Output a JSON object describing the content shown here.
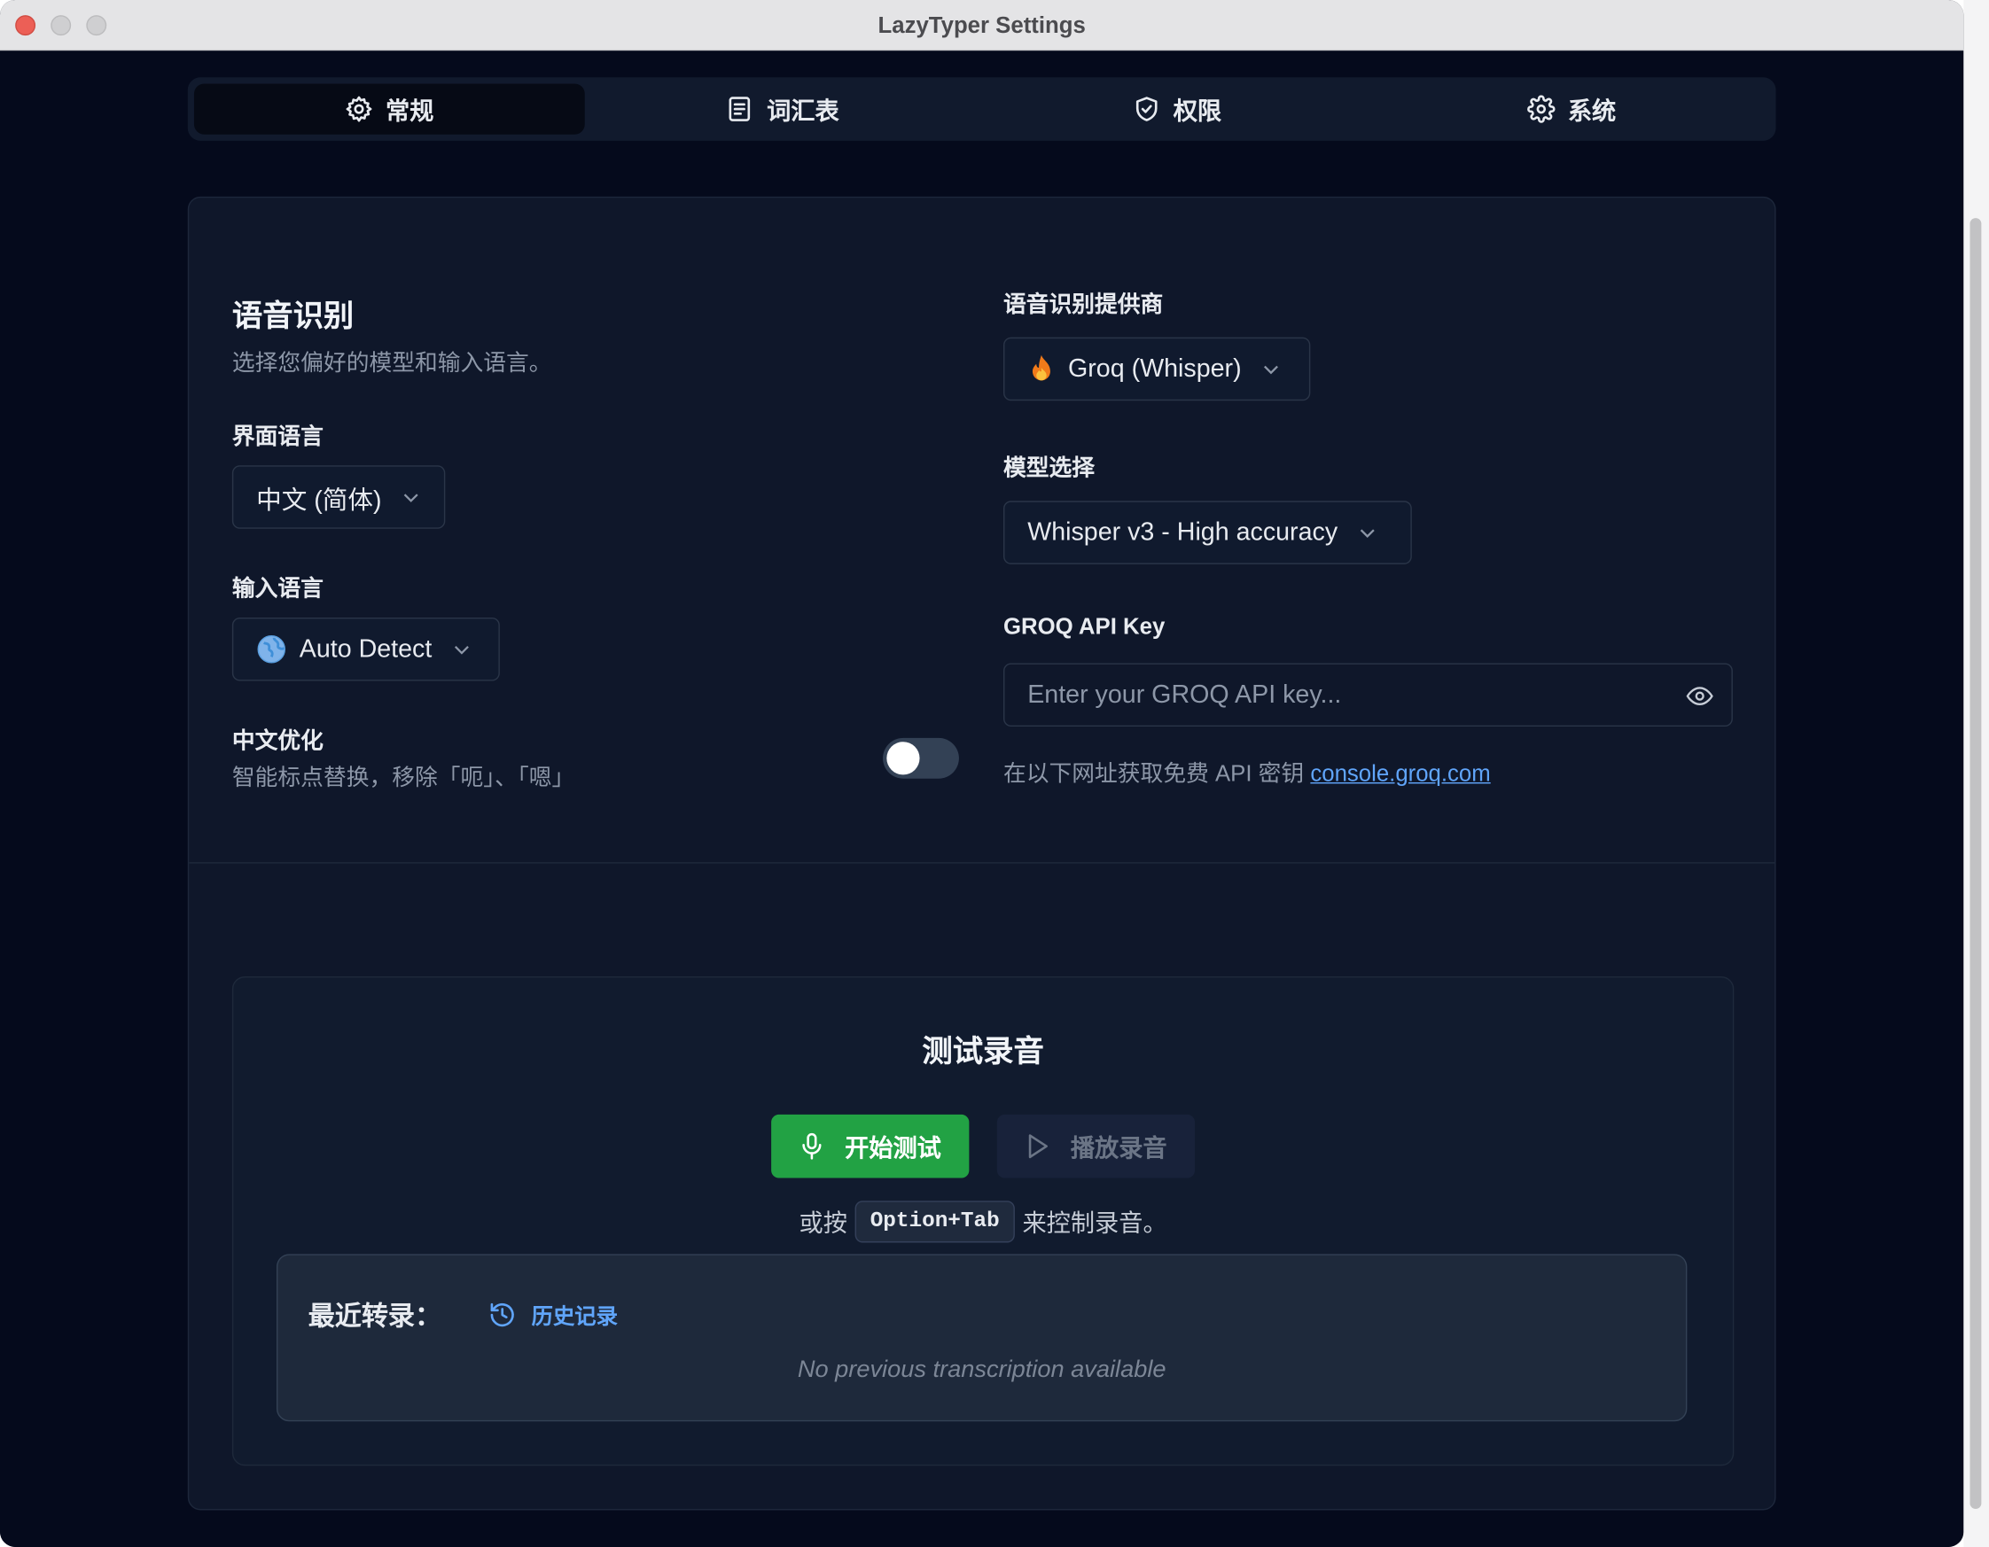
{
  "window": {
    "title": "LazyTyper Settings"
  },
  "tabs": [
    {
      "label": "常规",
      "icon": "gear-icon",
      "active": true
    },
    {
      "label": "词汇表",
      "icon": "document-icon",
      "active": false
    },
    {
      "label": "权限",
      "icon": "shield-check-icon",
      "active": false
    },
    {
      "label": "系统",
      "icon": "cog-icon",
      "active": false
    }
  ],
  "speech": {
    "title": "语音识别",
    "subtitle": "选择您偏好的模型和输入语言。",
    "ui_language": {
      "label": "界面语言",
      "value": "中文 (简体)"
    },
    "input_language": {
      "label": "输入语言",
      "icon": "globe-icon",
      "value": "Auto Detect"
    },
    "chinese_opt": {
      "label": "中文优化",
      "description": "智能标点替换，移除「呃」、「嗯」",
      "enabled": false
    }
  },
  "provider": {
    "label": "语音识别提供商",
    "icon": "fire-icon",
    "value": "Groq (Whisper)"
  },
  "model": {
    "label": "模型选择",
    "value": "Whisper v3 - High accuracy"
  },
  "api_key": {
    "label": "GROQ API Key",
    "placeholder": "Enter your GROQ API key...",
    "value": "",
    "help_text": "在以下网址获取免费 API 密钥",
    "link_text": "console.groq.com"
  },
  "test": {
    "title": "测试录音",
    "start_label": "开始测试",
    "play_label": "播放录音",
    "hint_before": "或按",
    "shortcut": "Option+Tab",
    "hint_after": "来控制录音。"
  },
  "recent": {
    "title": "最近转录：",
    "history_label": "历史记录",
    "empty_text": "No previous transcription available"
  },
  "colors": {
    "background": "#050a1c",
    "card": "#0f172a",
    "accent_green": "#22a244",
    "link_blue": "#60a5fa"
  }
}
